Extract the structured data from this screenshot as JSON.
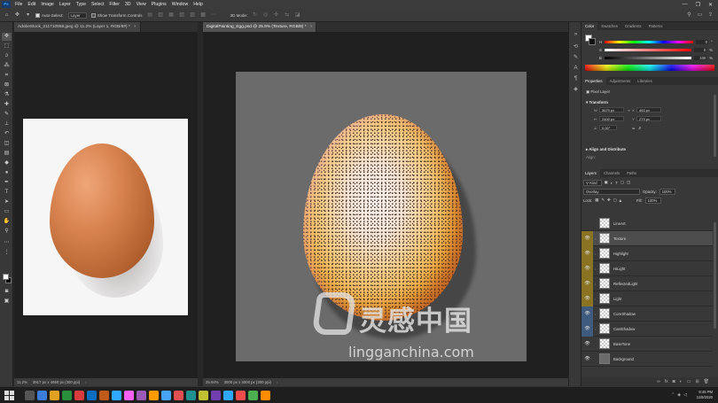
{
  "menubar": {
    "logo": "Ps",
    "items": [
      "File",
      "Edit",
      "Image",
      "Layer",
      "Type",
      "Select",
      "Filter",
      "3D",
      "View",
      "Plugins",
      "Window",
      "Help"
    ],
    "controls": [
      "—",
      "❐",
      "✕"
    ]
  },
  "options": {
    "auto_select_label": "Auto-Select:",
    "auto_select_value": "Layer",
    "transform_label": "Show Transform Controls",
    "mode_label": "3D Mode:"
  },
  "doc1": {
    "tab": "AdobeStock_211710958.jpeg @ 11.2% (Layer 1, RGB/8#) *",
    "zoom": "11.2%",
    "dims": "3917 px x 4650 px (300 ppi)"
  },
  "doc2": {
    "tab": "DigitalPainting_Egg.psd @ 25.9% (Texture, RGB/8) *",
    "zoom": "25.94%",
    "dims": "3000 px x 3000 px (300 ppi)"
  },
  "watermark": {
    "cn": "灵感中国",
    "en": "lingganchina.com"
  },
  "color_panel": {
    "tabs": [
      "Color",
      "Swatches",
      "Gradients",
      "Patterns"
    ],
    "rows": [
      {
        "label": "H",
        "value": "0"
      },
      {
        "label": "S",
        "value": "0"
      },
      {
        "label": "B",
        "value": "100"
      }
    ],
    "units": [
      "°",
      "%",
      "%"
    ]
  },
  "properties": {
    "tabs": [
      "Properties",
      "Adjustments",
      "Libraries"
    ],
    "kind": "Pixel Layer",
    "transform_title": "Transform",
    "w_label": "W",
    "w_value": "3679 px",
    "h_label": "H",
    "h_value": "2400 px",
    "x_label": "X",
    "x_value": "463 px",
    "y_label": "Y",
    "y_value": "273 px",
    "angle_value": "0.00°",
    "align_title": "Align and Distribute",
    "align_sub": "Align:"
  },
  "layers": {
    "tabs": [
      "Layers",
      "Channels",
      "Paths"
    ],
    "filter_value": "Kind",
    "blend_mode": "Overlay",
    "opacity_label": "Opacity:",
    "opacity_value": "100%",
    "lock_label": "Lock:",
    "fill_label": "Fill:",
    "fill_value": "100%",
    "items": [
      {
        "name": "LineArt",
        "visible": false,
        "tag": ""
      },
      {
        "name": "Texture",
        "visible": true,
        "tag": "yellow",
        "selected": true
      },
      {
        "name": "Highlight",
        "visible": true,
        "tag": "yellow"
      },
      {
        "name": "HiLight",
        "visible": true,
        "tag": "yellow"
      },
      {
        "name": "ReflectedLight",
        "visible": true,
        "tag": "yellow"
      },
      {
        "name": "Light",
        "visible": true,
        "tag": "yellow"
      },
      {
        "name": "CoreShadow",
        "visible": true,
        "tag": "blue"
      },
      {
        "name": "CastShadow",
        "visible": true,
        "tag": "blue"
      },
      {
        "name": "BaseTone",
        "visible": true,
        "tag": ""
      },
      {
        "name": "Background",
        "visible": true,
        "tag": ""
      }
    ],
    "footer_icons": [
      "link-icon",
      "fx-icon",
      "mask-icon",
      "adjustment-icon",
      "folder-icon",
      "new-layer-icon",
      "trash-icon"
    ]
  },
  "taskbar": {
    "time": "8:45 PM",
    "date": "11/9/2020"
  },
  "colors": {
    "accent_yellow_tag": "#8a7424",
    "accent_blue_tag": "#3f5c7e",
    "ps_blue": "#31a8ff"
  }
}
